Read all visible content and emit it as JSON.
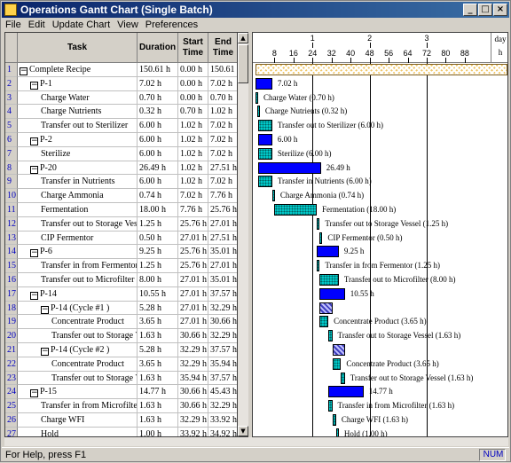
{
  "window": {
    "title": "Operations Gantt Chart (Single Batch)"
  },
  "title_buttons": [
    "_",
    "□",
    "×"
  ],
  "menu": [
    "File",
    "Edit",
    "Update Chart",
    "View",
    "Preferences"
  ],
  "table": {
    "columns": [
      "Task",
      "Duration",
      "Start Time",
      "End Time"
    ],
    "rows": [
      {
        "num": "1",
        "indent": 0,
        "exp": "−",
        "task": "Complete Recipe",
        "dur": "150.61 h",
        "start": "0.00 h",
        "end": "150.61 h"
      },
      {
        "num": "2",
        "indent": 1,
        "exp": "−",
        "task": "P-1",
        "dur": "7.02 h",
        "start": "0.00 h",
        "end": "7.02 h"
      },
      {
        "num": "3",
        "indent": 2,
        "exp": "",
        "task": "Charge Water",
        "dur": "0.70 h",
        "start": "0.00 h",
        "end": "0.70 h"
      },
      {
        "num": "4",
        "indent": 2,
        "exp": "",
        "task": "Charge Nutrients",
        "dur": "0.32 h",
        "start": "0.70 h",
        "end": "1.02 h"
      },
      {
        "num": "5",
        "indent": 2,
        "exp": "",
        "task": "Transfer out to Sterilizer",
        "dur": "6.00 h",
        "start": "1.02 h",
        "end": "7.02 h"
      },
      {
        "num": "6",
        "indent": 1,
        "exp": "−",
        "task": "P-2",
        "dur": "6.00 h",
        "start": "1.02 h",
        "end": "7.02 h"
      },
      {
        "num": "7",
        "indent": 2,
        "exp": "",
        "task": "Sterilize",
        "dur": "6.00 h",
        "start": "1.02 h",
        "end": "7.02 h"
      },
      {
        "num": "8",
        "indent": 1,
        "exp": "−",
        "task": "P-20",
        "dur": "26.49 h",
        "start": "1.02 h",
        "end": "27.51 h"
      },
      {
        "num": "9",
        "indent": 2,
        "exp": "",
        "task": "Transfer in Nutrients",
        "dur": "6.00 h",
        "start": "1.02 h",
        "end": "7.02 h"
      },
      {
        "num": "10",
        "indent": 2,
        "exp": "",
        "task": "Charge Ammonia",
        "dur": "0.74 h",
        "start": "7.02 h",
        "end": "7.76 h"
      },
      {
        "num": "11",
        "indent": 2,
        "exp": "",
        "task": "Fermentation",
        "dur": "18.00 h",
        "start": "7.76 h",
        "end": "25.76 h"
      },
      {
        "num": "12",
        "indent": 2,
        "exp": "",
        "task": "Transfer out to Storage Ves",
        "dur": "1.25 h",
        "start": "25.76 h",
        "end": "27.01 h"
      },
      {
        "num": "13",
        "indent": 2,
        "exp": "",
        "task": "CIP Fermentor",
        "dur": "0.50 h",
        "start": "27.01 h",
        "end": "27.51 h"
      },
      {
        "num": "14",
        "indent": 1,
        "exp": "−",
        "task": "P-6",
        "dur": "9.25 h",
        "start": "25.76 h",
        "end": "35.01 h"
      },
      {
        "num": "15",
        "indent": 2,
        "exp": "",
        "task": "Transfer in from Fermentor",
        "dur": "1.25 h",
        "start": "25.76 h",
        "end": "27.01 h"
      },
      {
        "num": "16",
        "indent": 2,
        "exp": "",
        "task": "Transfer out to Microfilter",
        "dur": "8.00 h",
        "start": "27.01 h",
        "end": "35.01 h"
      },
      {
        "num": "17",
        "indent": 1,
        "exp": "−",
        "task": "P-14",
        "dur": "10.55 h",
        "start": "27.01 h",
        "end": "37.57 h"
      },
      {
        "num": "18",
        "indent": 2,
        "exp": "−",
        "task": "P-14 (Cycle #1 )",
        "dur": "5.28 h",
        "start": "27.01 h",
        "end": "32.29 h"
      },
      {
        "num": "19",
        "indent": 3,
        "exp": "",
        "task": "Concentrate Product",
        "dur": "3.65 h",
        "start": "27.01 h",
        "end": "30.66 h"
      },
      {
        "num": "20",
        "indent": 3,
        "exp": "",
        "task": "Transfer out to Storage Ve",
        "dur": "1.63 h",
        "start": "30.66 h",
        "end": "32.29 h"
      },
      {
        "num": "21",
        "indent": 2,
        "exp": "−",
        "task": "P-14 (Cycle #2 )",
        "dur": "5.28 h",
        "start": "32.29 h",
        "end": "37.57 h"
      },
      {
        "num": "22",
        "indent": 3,
        "exp": "",
        "task": "Concentrate Product",
        "dur": "3.65 h",
        "start": "32.29 h",
        "end": "35.94 h"
      },
      {
        "num": "23",
        "indent": 3,
        "exp": "",
        "task": "Transfer out to Storage Ve",
        "dur": "1.63 h",
        "start": "35.94 h",
        "end": "37.57 h"
      },
      {
        "num": "24",
        "indent": 1,
        "exp": "−",
        "task": "P-15",
        "dur": "14.77 h",
        "start": "30.66 h",
        "end": "45.43 h"
      },
      {
        "num": "25",
        "indent": 2,
        "exp": "",
        "task": "Transfer in from Microfilte",
        "dur": "1.63 h",
        "start": "30.66 h",
        "end": "32.29 h"
      },
      {
        "num": "26",
        "indent": 2,
        "exp": "",
        "task": "Charge WFI",
        "dur": "1.63 h",
        "start": "32.29 h",
        "end": "33.92 h"
      },
      {
        "num": "27",
        "indent": 2,
        "exp": "",
        "task": "Hold",
        "dur": "1.00 h",
        "start": "33.92 h",
        "end": "34.92 h"
      }
    ]
  },
  "gantt": {
    "scale_top": [
      "1",
      "2",
      "3"
    ],
    "scale_bottom": [
      "8",
      "16",
      "24",
      "32",
      "40",
      "48",
      "56",
      "64",
      "72",
      "80",
      "88"
    ],
    "day_unit": "day",
    "hour_unit": "h",
    "bars": [
      {
        "row": 0,
        "kind": "recipe",
        "start": 0,
        "end": 150.61,
        "label": ""
      },
      {
        "row": 1,
        "kind": "sum",
        "start": 0,
        "end": 7.02,
        "label": "7.02 h"
      },
      {
        "row": 2,
        "kind": "op",
        "start": 0,
        "end": 0.7,
        "label": "Charge Water (0.70 h)"
      },
      {
        "row": 3,
        "kind": "op",
        "start": 0.7,
        "end": 1.02,
        "label": "Charge Nutrients (0.32 h)"
      },
      {
        "row": 4,
        "kind": "op",
        "start": 1.02,
        "end": 7.02,
        "label": "Transfer out to Sterilizer (6.00 h)"
      },
      {
        "row": 5,
        "kind": "sum",
        "start": 1.02,
        "end": 7.02,
        "label": "6.00 h"
      },
      {
        "row": 6,
        "kind": "op",
        "start": 1.02,
        "end": 7.02,
        "label": "Sterilize (6.00 h)"
      },
      {
        "row": 7,
        "kind": "sum",
        "start": 1.02,
        "end": 27.51,
        "label": "26.49 h"
      },
      {
        "row": 8,
        "kind": "op",
        "start": 1.02,
        "end": 7.02,
        "label": "Transfer in Nutrients (6.00 h)"
      },
      {
        "row": 9,
        "kind": "op",
        "start": 7.02,
        "end": 7.76,
        "label": "Charge Ammonia (0.74 h)"
      },
      {
        "row": 10,
        "kind": "op",
        "start": 7.76,
        "end": 25.76,
        "label": "Fermentation (18.00 h)"
      },
      {
        "row": 11,
        "kind": "op",
        "start": 25.76,
        "end": 27.01,
        "label": "Transfer out to Storage Vessel (1.25 h)"
      },
      {
        "row": 12,
        "kind": "op",
        "start": 27.01,
        "end": 27.51,
        "label": "CIP Fermentor (0.50 h)"
      },
      {
        "row": 13,
        "kind": "sum",
        "start": 25.76,
        "end": 35.01,
        "label": "9.25 h"
      },
      {
        "row": 14,
        "kind": "op",
        "start": 25.76,
        "end": 27.01,
        "label": "Transfer in from Fermentor (1.25 h)"
      },
      {
        "row": 15,
        "kind": "op",
        "start": 27.01,
        "end": 35.01,
        "label": "Transfer out to Microfilter (8.00 h)"
      },
      {
        "row": 16,
        "kind": "sum",
        "start": 27.01,
        "end": 37.57,
        "label": "10.55 h"
      },
      {
        "row": 17,
        "kind": "cyc",
        "start": 27.01,
        "end": 32.29,
        "label": ""
      },
      {
        "row": 18,
        "kind": "op",
        "start": 27.01,
        "end": 30.66,
        "label": "Concentrate Product (3.65 h)"
      },
      {
        "row": 19,
        "kind": "op",
        "start": 30.66,
        "end": 32.29,
        "label": "Transfer out to Storage Vessel (1.63 h)"
      },
      {
        "row": 20,
        "kind": "cyc",
        "start": 32.29,
        "end": 37.57,
        "label": ""
      },
      {
        "row": 21,
        "kind": "op",
        "start": 32.29,
        "end": 35.94,
        "label": "Concentrate Product (3.65 h)"
      },
      {
        "row": 22,
        "kind": "op",
        "start": 35.94,
        "end": 37.57,
        "label": "Transfer out to Storage Vessel (1.63 h)"
      },
      {
        "row": 23,
        "kind": "sum",
        "start": 30.66,
        "end": 45.43,
        "label": "14.77 h"
      },
      {
        "row": 24,
        "kind": "op",
        "start": 30.66,
        "end": 32.29,
        "label": "Transfer in from Microfilter (1.63 h)"
      },
      {
        "row": 25,
        "kind": "op",
        "start": 32.29,
        "end": 33.92,
        "label": "Charge WFI (1.63 h)"
      },
      {
        "row": 26,
        "kind": "op",
        "start": 33.92,
        "end": 34.92,
        "label": "Hold (1.00 h)"
      }
    ]
  },
  "status": {
    "message": "For Help, press F1",
    "num": "NUM"
  }
}
